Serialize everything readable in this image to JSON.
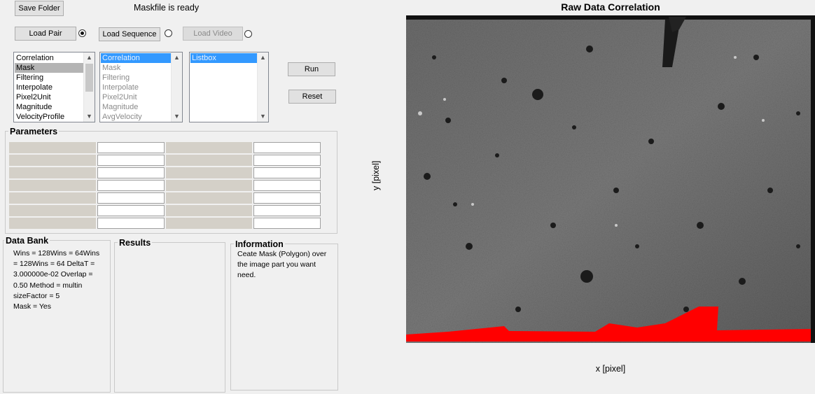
{
  "toolbar": {
    "save_folder_label": "Save Folder",
    "status_text": "Maskfile is ready",
    "load_pair_label": "Load Pair",
    "load_sequence_label": "Load Sequence",
    "load_video_label": "Load Video",
    "run_label": "Run",
    "reset_label": "Reset",
    "selected_source": "Load Pair"
  },
  "lists": {
    "steps": [
      "Correlation",
      "Mask",
      "Filtering",
      "Interpolate",
      "Pixel2Unit",
      "Magnitude",
      "VelocityProfile"
    ],
    "steps_selected": "Mask",
    "queue": [
      "Correlation",
      "Mask",
      "Filtering",
      "Interpolate",
      "Pixel2Unit",
      "Magnitude",
      "AvgVelocity"
    ],
    "queue_selected": "Correlation",
    "listbox": [
      "Listbox"
    ],
    "listbox_selected": "Listbox"
  },
  "parameters": {
    "title": "Parameters"
  },
  "data_bank": {
    "title": "Data Bank",
    "lines": [
      "Wins = 128Wins = 64Wins",
      "= 128Wins = 64  DeltaT =",
      "3.000000e-02  Overlap =",
      "0.50  Method = multin",
      "sizeFactor = 5",
      "Mask = Yes"
    ]
  },
  "results": {
    "title": "Results"
  },
  "information": {
    "title": "Information",
    "lines": [
      "Ceate Mask (Polygon) over",
      "the image part you want",
      "need."
    ]
  },
  "plot": {
    "title": "Raw Data Correlation",
    "xlabel": "x [pixel]",
    "ylabel": "y [pixel]",
    "mask_color": "#ff0000"
  }
}
